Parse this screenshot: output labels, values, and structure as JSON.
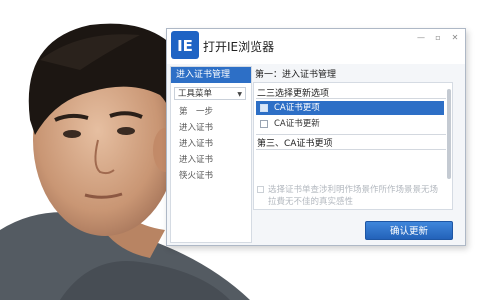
{
  "window": {
    "title": "打开IE浏览器",
    "logo_text": "IE",
    "min_glyph": "—",
    "restore_glyph": "▫",
    "close_glyph": "✕"
  },
  "sidebar": {
    "header": "进入证书管理",
    "dropdown": "工具菜单",
    "dropdown_caret": "▼",
    "items": [
      "第　一步",
      "进入证书",
      "进入证书",
      "进入证书",
      "筷火证书"
    ]
  },
  "content": {
    "step_title": "第一：进入证书管理",
    "section2": "二三选择更新选项",
    "options": [
      {
        "label": "CA证书更项",
        "selected": true
      },
      {
        "label": "CA证书更新",
        "selected": false
      }
    ],
    "section3": "第三、CA证书更项",
    "description": "选择证书单查涉利明作场景作所作场景景无场拉費无不佳的真实感性"
  },
  "footer": {
    "confirm_label": "确认更新"
  },
  "colors": {
    "accent": "#2d6fc6",
    "window_bg": "#f4f6f9"
  }
}
